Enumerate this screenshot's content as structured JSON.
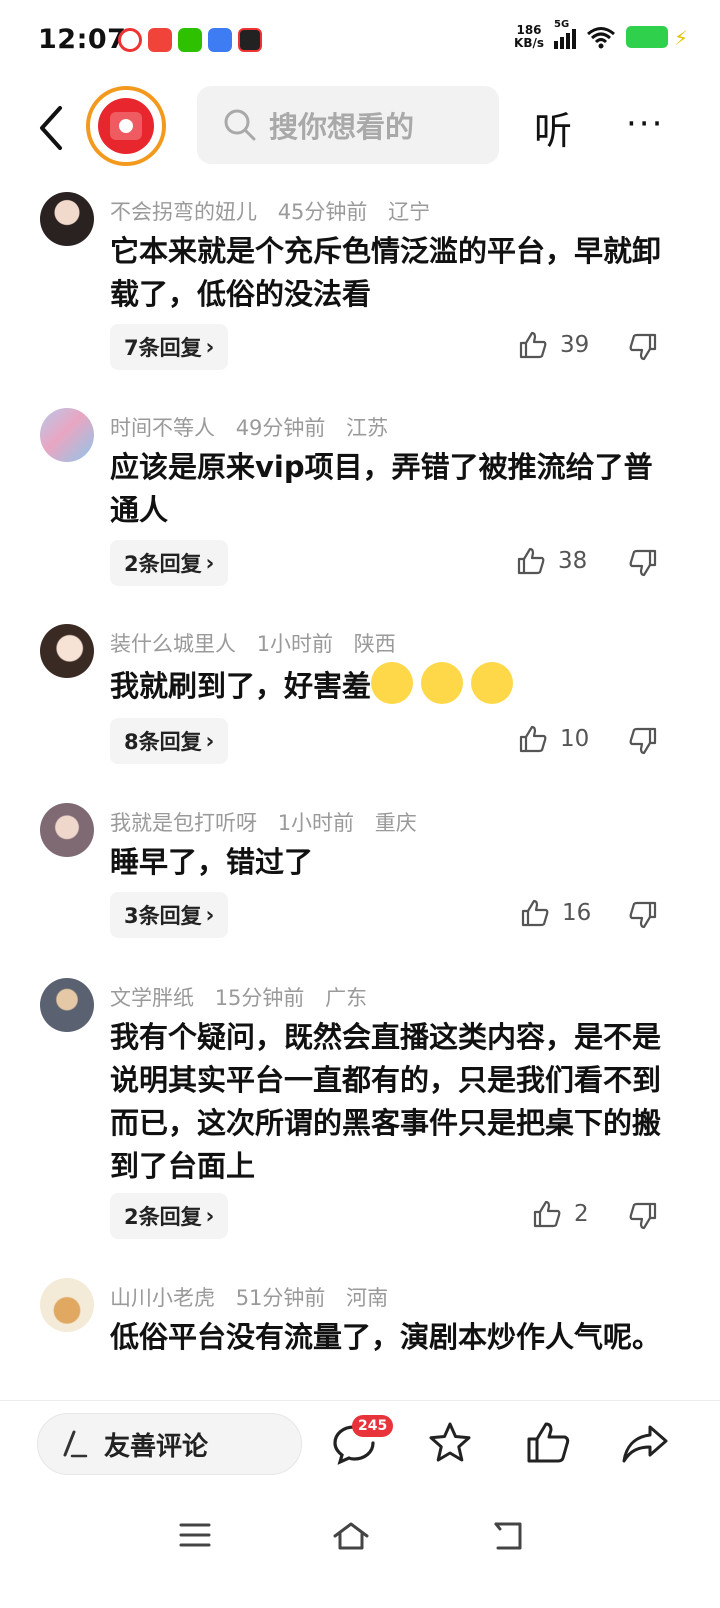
{
  "status_bar": {
    "time": "12:07",
    "net_speed_value": "186",
    "net_speed_unit": "KB/s",
    "signal_label": "5G",
    "colors": {
      "battery": "#2fd04c"
    }
  },
  "topnav": {
    "search_placeholder": "搜你想看的",
    "listen_label": "听",
    "more_label": "···"
  },
  "comments": [
    {
      "user": "不会拐弯的妞儿",
      "time": "45分钟前",
      "location": "辽宁",
      "text": "它本来就是个充斥色情泛滥的平台，早就卸载了，低俗的没法看",
      "replies": "7条回复",
      "likes": "39"
    },
    {
      "user": "时间不等人",
      "time": "49分钟前",
      "location": "江苏",
      "text": "应该是原来vip项目，弄错了被推流给了普通人",
      "replies": "2条回复",
      "likes": "38"
    },
    {
      "user": "装什么城里人",
      "time": "1小时前",
      "location": "陕西",
      "text": "我就刷到了，好害羞",
      "replies": "8条回复",
      "likes": "10"
    },
    {
      "user": "我就是包打听呀",
      "time": "1小时前",
      "location": "重庆",
      "text": "睡早了，错过了",
      "replies": "3条回复",
      "likes": "16"
    },
    {
      "user": "文学胖纸",
      "time": "15分钟前",
      "location": "广东",
      "text": "我有个疑问，既然会直播这类内容，是不是说明其实平台一直都有的，只是我们看不到而已，这次所谓的黑客事件只是把桌下的搬到了台面上",
      "replies": "2条回复",
      "likes": "2"
    },
    {
      "user": "山川小老虎",
      "time": "51分钟前",
      "location": "河南",
      "text": "低俗平台没有流量了，演剧本炒作人气呢。"
    }
  ],
  "bottom_bar": {
    "comment_placeholder": "友善评论",
    "comment_count": "245"
  }
}
